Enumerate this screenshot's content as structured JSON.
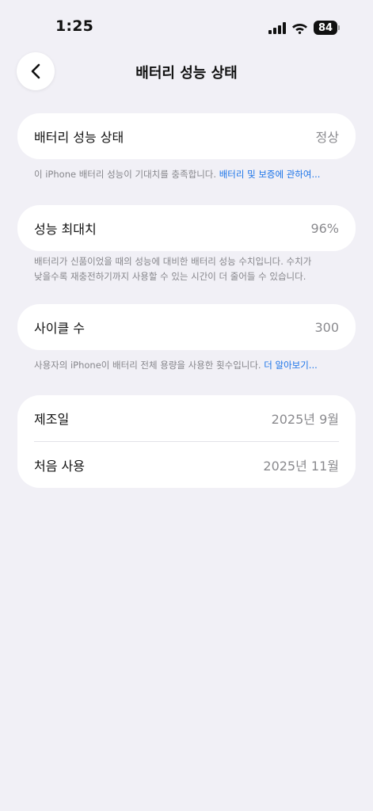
{
  "status_bar": {
    "time": "1:25",
    "battery_level": "84",
    "icons": [
      "cellular-signal-icon",
      "wifi-icon",
      "battery-icon"
    ]
  },
  "nav": {
    "back_icon": "chevron-left-icon",
    "title": "배터리 성능 상태"
  },
  "battery_health": {
    "label": "배터리 성능 상태",
    "value": "정상",
    "footnote": "이 iPhone 배터리 성능이 기대치를 충족합니다.",
    "link": "배터리 및 보증에 관하여..."
  },
  "max_capacity": {
    "label": "성능 최대치",
    "value": "96%",
    "footnote_line1": "배터리가 신품이었을 때의 성능에 대비한 배터리 성능 수치입니다. 수치가",
    "footnote_line2": "낮을수록 재충전하기까지 사용할 수 있는 시간이 더 줄어들 수 있습니다."
  },
  "cycle_count": {
    "label": "사이클 수",
    "value": "300",
    "footnote": "사용자의 iPhone이 배터리 전체 용량을 사용한 횟수입니다.",
    "link": "더 알아보기..."
  },
  "dates": {
    "manufacture_label": "제조일",
    "manufacture_value": "2025년 9월",
    "first_use_label": "처음 사용",
    "first_use_value": "2025년 11월"
  },
  "colors": {
    "background": "#f1f0f6",
    "card": "#ffffff",
    "secondary_text": "#8a8a8e",
    "link": "#1a73e8"
  }
}
